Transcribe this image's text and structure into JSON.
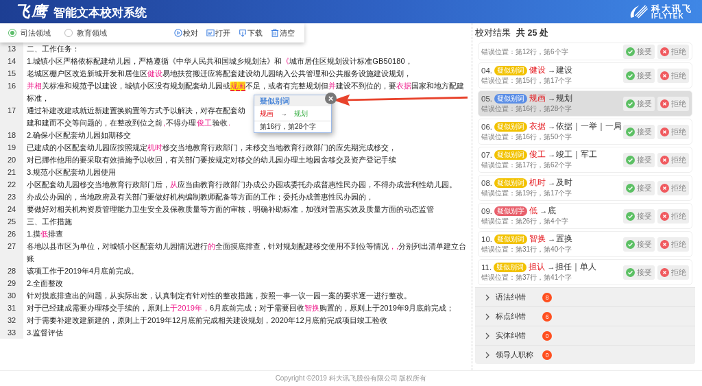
{
  "header": {
    "logo_text": "飞鹰",
    "title": "智能文本校对系统",
    "brand_cn": "科大讯飞",
    "brand_en": "IFLYTEK"
  },
  "domains": [
    {
      "label": "司法领域",
      "selected": true
    },
    {
      "label": "教育领域",
      "selected": false
    }
  ],
  "toolbar": [
    {
      "kind": "proofread",
      "label": "校对"
    },
    {
      "kind": "open",
      "label": "打开"
    },
    {
      "kind": "download",
      "label": "下载"
    },
    {
      "kind": "clear",
      "label": "清空"
    }
  ],
  "document": {
    "lines": [
      {
        "num": "13",
        "segments": [
          {
            "text": "二、工作任务："
          }
        ]
      },
      {
        "num": "14",
        "segments": [
          {
            "text": "1.城镇小区严格依标配建幼儿园，严格遵循《中华人民共和国城乡规划法》和"
          },
          {
            "text": "《",
            "error": true
          },
          {
            "text": "城市居住区规划设计标准GB50180，"
          }
        ]
      },
      {
        "num": "15",
        "segments": [
          {
            "text": "老城区棚户区改造新城开发和居住区"
          },
          {
            "text": "健设",
            "error": true
          },
          {
            "text": "易地扶贫搬迁应将配套建设幼儿园纳入公共管理和公共服务设施建设规划，"
          }
        ]
      },
      {
        "num": "16",
        "segments": [
          {
            "text": "并相",
            "error": true
          },
          {
            "text": "关标准和规范予以建设，城镇小区没有规划配套幼儿园或"
          },
          {
            "text": "规画",
            "error": true,
            "focus": true
          },
          {
            "text": "不足，或者有完整规划但"
          },
          {
            "text": "并",
            "error": true
          },
          {
            "text": "建设不到位的，要"
          },
          {
            "text": "衣据",
            "error": true
          },
          {
            "text": "国家和地方配建标准，"
          }
        ]
      },
      {
        "num": "17",
        "segments": [
          {
            "text": "通过补建改建或就近新建置换购置等方式予以解决，对存在配套幼"
          },
          {
            "gap": true
          },
          {
            "text": "建和建而不交等问题的，在整改到位之前"
          },
          {
            "text": ",",
            "error": true
          },
          {
            "text": "不得办理"
          },
          {
            "text": "俊工",
            "error": true
          },
          {
            "text": "验收"
          },
          {
            "text": ".",
            "error": true
          }
        ]
      },
      {
        "num": "18",
        "segments": [
          {
            "text": "2.确保小区配套幼儿园如期移交"
          }
        ]
      },
      {
        "num": "19",
        "segments": [
          {
            "text": "已建成的小区配套幼儿园应按照规定"
          },
          {
            "text": "机时",
            "error": true
          },
          {
            "text": "移交当地教育行政部门，未移交当地教育行政部门的应先期完成移交，"
          }
        ]
      },
      {
        "num": "20",
        "segments": [
          {
            "text": "对已挪作他用的要采取有效措施予以收回，有关部门要按规定对移交的幼儿园办理土地园舍移交及资产登记手续"
          }
        ]
      },
      {
        "num": "21",
        "segments": [
          {
            "text": "3.规范小区配套幼儿园使用"
          }
        ]
      },
      {
        "num": "22",
        "segments": [
          {
            "text": "小区配套幼儿园移交当地教育行政部门后，"
          },
          {
            "text": "从",
            "error": true
          },
          {
            "text": "应当由教育行政部门办成公办园或委托办成普惠性民办园，不得办成营利性幼儿园。"
          }
        ]
      },
      {
        "num": "23",
        "segments": [
          {
            "text": "办成公办园的，当地政府及有关部门要做好机构编制教师配备等方面的工作；委托办成普惠性民办园的，"
          }
        ]
      },
      {
        "num": "24",
        "segments": [
          {
            "text": "要做好对相关机构资质管理能力卫生安全及保教质量等方面的审核，明确补助标准，加强对普惠实效及质量方面的动态监管"
          }
        ]
      },
      {
        "num": "25",
        "segments": [
          {
            "text": "三、工作措施"
          }
        ]
      },
      {
        "num": "26",
        "segments": [
          {
            "text": "1.摸"
          },
          {
            "text": "低",
            "error": true
          },
          {
            "text": "排查"
          }
        ]
      },
      {
        "num": "27",
        "segments": [
          {
            "text": "各地以县市区为单位，对城镇小区配套幼儿园情况进行"
          },
          {
            "text": "的",
            "error": true
          },
          {
            "text": "全面摸底排查，针对规划配建移交使用不到位等情况"
          },
          {
            "text": "，,",
            "error": true
          },
          {
            "text": "分别列出清单建立台账"
          }
        ]
      },
      {
        "num": "28",
        "segments": [
          {
            "text": "该项工作于2019年4月底前完成。"
          }
        ]
      },
      {
        "num": "29",
        "segments": [
          {
            "text": "2.全面整改"
          }
        ]
      },
      {
        "num": "30",
        "segments": [
          {
            "text": "针对摸底排查出的问题，从实际出发，认真制定有针对性的整改措施，按照一事一议一园一案的要求逐一进行整改。"
          }
        ]
      },
      {
        "num": "31",
        "segments": [
          {
            "text": "对于已经建成需要办理移交手续的，原则上"
          },
          {
            "text": "于2019年，",
            "error": true
          },
          {
            "text": "6月底前完成；对于需要回收"
          },
          {
            "text": "智换",
            "error": true
          },
          {
            "text": "购置的，原则上于2019年9月底前完成；"
          }
        ]
      },
      {
        "num": "32",
        "segments": [
          {
            "text": "对于需要补建改建新建的，原则上于2019年12月底前完成相关建设规划，2020年12月底前完成项目竣工验收"
          }
        ]
      },
      {
        "num": "33",
        "segments": [
          {
            "text": "3.监督评估"
          }
        ]
      }
    ]
  },
  "popup": {
    "title": "疑似别词",
    "wrong": "规画",
    "arrow": "→",
    "right": "规划",
    "location": "第16行，第28个字",
    "close": "×"
  },
  "results": {
    "title": "校对结果",
    "total": "共 25 处",
    "items": [
      {
        "cut": true,
        "location": "错误位置：第12行，第6个字",
        "accept": "接受",
        "reject": "拒绝",
        "selected": false
      },
      {
        "num": "04.",
        "tag": "疑似别词",
        "color": "#f2c200",
        "wrong": "健设",
        "suggest": "→建设",
        "location": "错误位置：第15行，第17个字",
        "accept": "接受",
        "reject": "拒绝",
        "selected": false
      },
      {
        "num": "05.",
        "tag": "疑似别词",
        "color": "#5b8ee6",
        "wrong": "规画",
        "suggest": "→规划",
        "location": "错误位置：第16行，第28个字",
        "accept": "接受",
        "reject": "拒绝",
        "selected": true
      },
      {
        "num": "06.",
        "tag": "疑似别词",
        "color": "#f2c200",
        "wrong": "衣据",
        "suggest": "→依据｜一举｜一局",
        "location": "错误位置：第16行，第50个字",
        "accept": "接受",
        "reject": "拒绝",
        "selected": false
      },
      {
        "num": "07.",
        "tag": "疑似别词",
        "color": "#f2c200",
        "wrong": "俊工",
        "suggest": "→竣工｜军工",
        "location": "错误位置：第17行，第62个字",
        "accept": "接受",
        "reject": "拒绝",
        "selected": false
      },
      {
        "num": "08.",
        "tag": "疑似别词",
        "color": "#f2c200",
        "wrong": "机时",
        "suggest": "→及时",
        "location": "错误位置：第19行，第17个字",
        "accept": "接受",
        "reject": "拒绝",
        "selected": false
      },
      {
        "num": "09.",
        "tag": "疑似别字",
        "color": "#e8606c",
        "wrong": "低",
        "suggest": "→底",
        "location": "错误位置：第26行，第4个字",
        "accept": "接受",
        "reject": "拒绝",
        "selected": false
      },
      {
        "num": "10.",
        "tag": "疑似别词",
        "color": "#f2c200",
        "wrong": "智换",
        "suggest": "→置换",
        "location": "错误位置：第31行，第40个字",
        "accept": "接受",
        "reject": "拒绝",
        "selected": false
      },
      {
        "num": "11.",
        "tag": "疑似别词",
        "color": "#f2c200",
        "wrong": "担认",
        "suggest": "→担任｜单人",
        "location": "错误位置：第37行，第41个字",
        "accept": "接受",
        "reject": "拒绝",
        "selected": false
      }
    ],
    "categories": [
      {
        "label": "语法纠错",
        "count": "8",
        "expanded": false
      },
      {
        "label": "标点纠错",
        "count": "6",
        "expanded": false
      },
      {
        "label": "实体纠错",
        "count": "0",
        "expanded": false
      },
      {
        "label": "领导人职称",
        "count": "0",
        "expanded": false
      }
    ]
  },
  "footer": "Copyright ©2019 科大讯飞股份有限公司 版权所有"
}
